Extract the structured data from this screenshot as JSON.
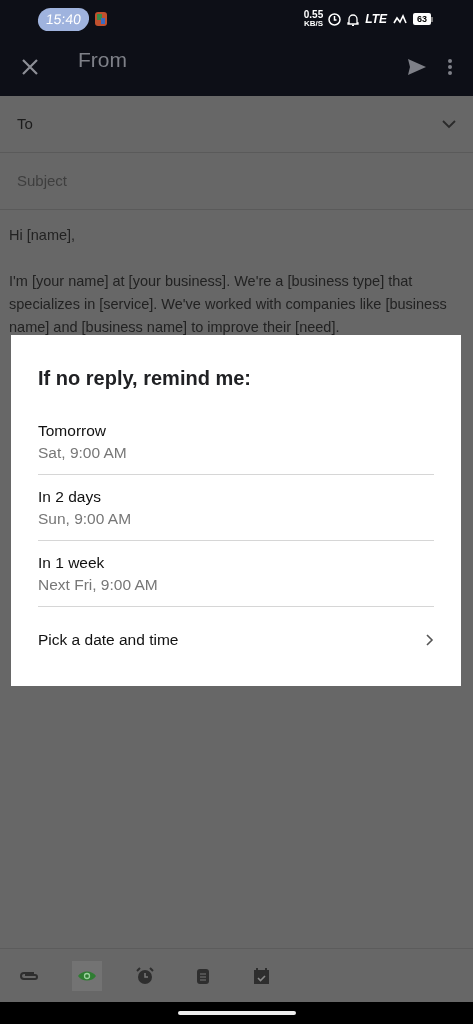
{
  "status_bar": {
    "time": "15:40",
    "speed": "0.55",
    "speed_unit": "KB/S",
    "network": "LTE",
    "battery": "63"
  },
  "header": {
    "title": "From"
  },
  "fields": [
    {
      "kind": "dropdown",
      "label": "To"
    },
    {
      "kind": "text",
      "placeholder": "Subject"
    }
  ],
  "body": [
    "Hi [name],",
    "I'm [your name] at [your business]. We're a [business type] that specializes in [service]. We've worked with companies like [business name] and [business name] to improve their [need]."
  ],
  "dialog": {
    "title": "If no reply, remind me:",
    "options": [
      {
        "kind": "preset",
        "label": "Tomorrow",
        "detail": "Sat, 9:00 AM"
      },
      {
        "kind": "preset",
        "label": "In 2 days",
        "detail": "Sun, 9:00 AM"
      },
      {
        "kind": "preset",
        "label": "In 1 week",
        "detail": "Next Fri, 9:00 AM"
      },
      {
        "kind": "picker",
        "label": "Pick a date and time"
      }
    ]
  },
  "toolbar": [
    {
      "kind": "attach",
      "selected": false
    },
    {
      "kind": "eye",
      "selected": true
    },
    {
      "kind": "alarm",
      "selected": false
    },
    {
      "kind": "template",
      "selected": false
    },
    {
      "kind": "calendar",
      "selected": false
    }
  ]
}
